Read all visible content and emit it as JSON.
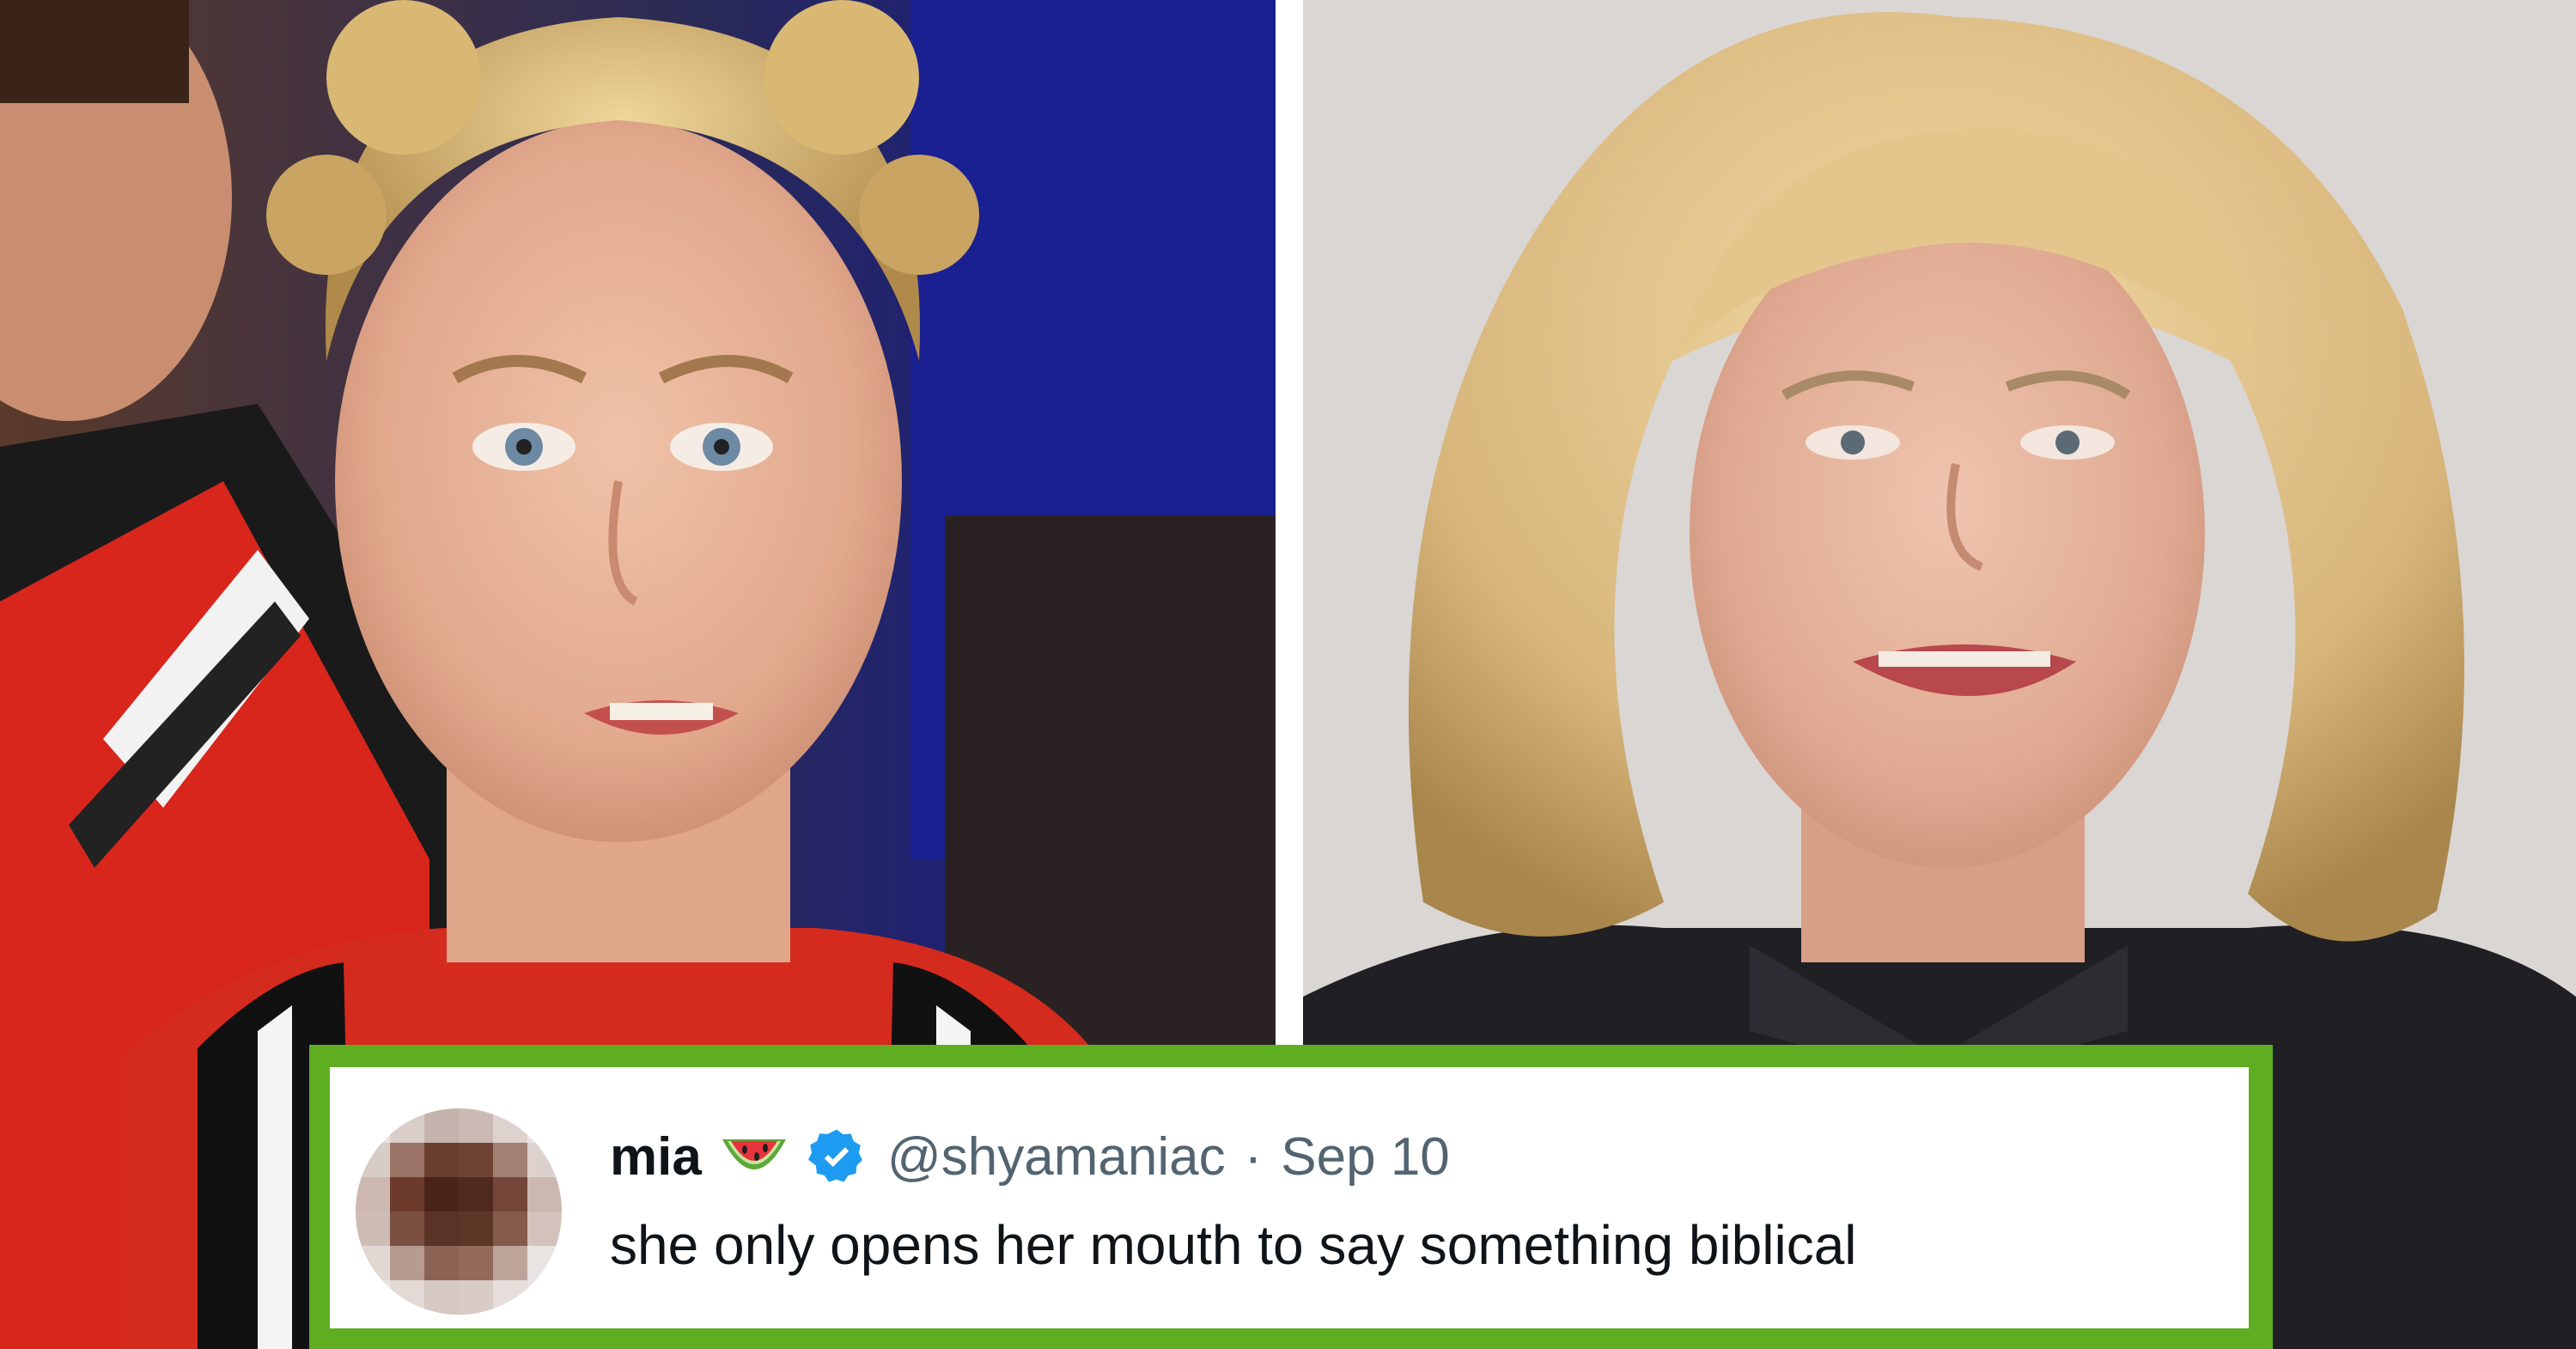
{
  "images": {
    "left_photo_icon": "cheerleader-photo",
    "right_photo_icon": "interview-photo"
  },
  "tweet": {
    "display_name": "mia",
    "name_emoji": "watermelon-icon",
    "verified_icon": "verified-badge-icon",
    "handle": "@shyamaniac",
    "separator": "·",
    "date": "Sep 10",
    "text": "she only opens her mouth to say something biblical",
    "avatar_icon": "blurred-avatar"
  },
  "colors": {
    "frame_green": "#5fae22",
    "verified_blue": "#1d9bf0",
    "handle_gray": "#536471",
    "text_dark": "#0f1419"
  }
}
